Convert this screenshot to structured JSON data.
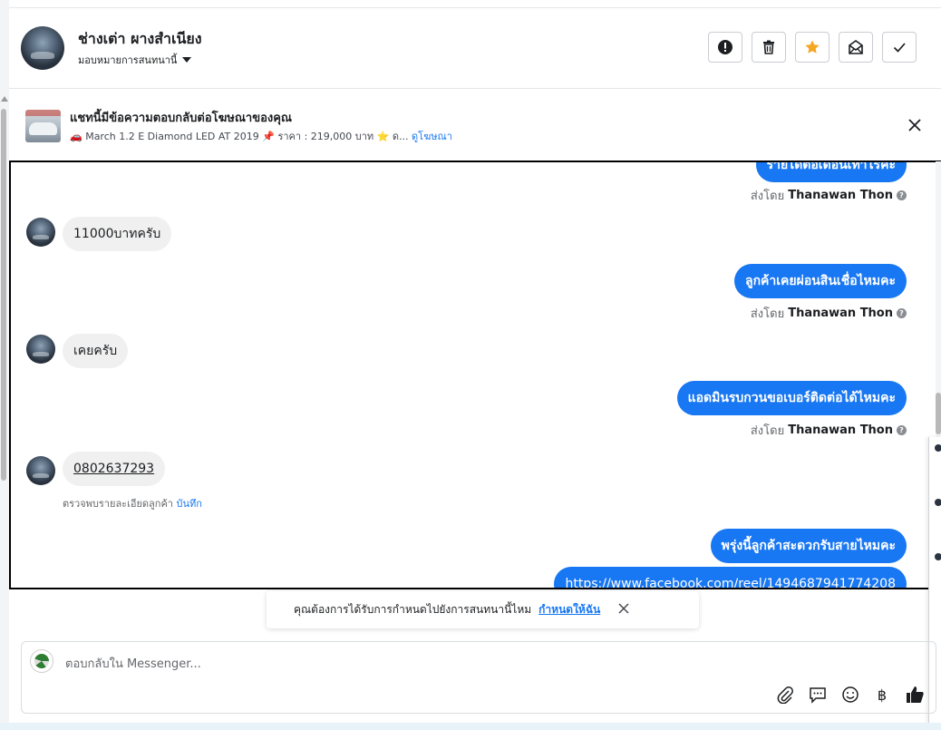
{
  "header": {
    "contact_name": "ช่างเต่า ผางสำเนียง",
    "assign_label": "มอบหมายการสนทนานี้"
  },
  "actions": {
    "items": [
      {
        "name": "spam-button",
        "icon": "alert-circle-icon"
      },
      {
        "name": "delete-button",
        "icon": "trash-icon"
      },
      {
        "name": "star-button",
        "icon": "star-icon",
        "color": "#f5a623"
      },
      {
        "name": "mark-unread-button",
        "icon": "mail-open-icon"
      },
      {
        "name": "mark-done-button",
        "icon": "check-icon"
      }
    ]
  },
  "ad_banner": {
    "title": "แชทนี้มีข้อความตอบกลับต่อโฆษณาของคุณ",
    "car_emoji": "🚗",
    "description": "March 1.2 E Diamond LED AT 2019",
    "pin_emoji": "📌",
    "price_text": "ราคา : 219,000 บาท",
    "star_emoji": "⭐",
    "truncated": "ด...",
    "link_label": "ดูโฆษณา"
  },
  "messages": {
    "m0_text": "รายได้ต่อเดือนเท่าไรคะ",
    "sent_by_prefix": "ส่งโดย",
    "agent_name": "Thanawan Thon",
    "m1_text": "11000บาทครับ",
    "m2_text": "ลูกค้าเคยผ่อนสินเชื่อไหมคะ",
    "m3_text": "เคยครับ",
    "m4_text": "แอดมินรบกวนขอเบอร์ติดต่อได้ไหมคะ",
    "m5_text": "0802637293",
    "note_prefix": "ตรวจพบรายละเอียดลูกค้า",
    "note_link": "บันทึก",
    "m6_text": "พรุ่งนี้ลูกค้าสะดวกรับสายไหมคะ",
    "m7_text": "https://www.facebook.com/reel/1494687941774208"
  },
  "toast": {
    "text": "คุณต้องการได้รับการกำหนดไปยังการสนทนานี้ไหม",
    "link": "กำหนดให้ฉัน"
  },
  "composer": {
    "placeholder": "ตอบกลับใน Messenger...",
    "tools": [
      "paperclip-icon",
      "quick-reply-icon",
      "emoji-icon",
      "baht-icon",
      "thumbs-up-icon"
    ],
    "baht_symbol": "฿"
  },
  "colors": {
    "accent": "#1877f2",
    "outgoing_bubble": "#1877f2",
    "incoming_bubble": "#f0f0f0",
    "star": "#f5a623"
  }
}
